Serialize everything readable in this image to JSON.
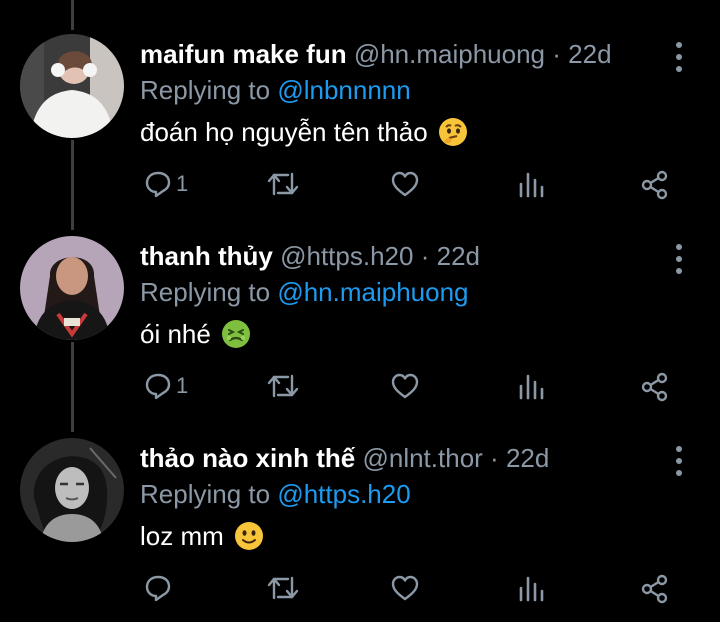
{
  "tweets": [
    {
      "name": "maifun make fun",
      "handle": "@hn.maiphuong",
      "separator": "·",
      "time": "22d",
      "replying_prefix": "Replying to",
      "replying_to": "@lnbnnnnn",
      "text": "đoán họ nguyễn tên thảo",
      "emoji": "thinking-face",
      "reply_count": "1"
    },
    {
      "name": "thanh thủy",
      "handle": "@https.h20",
      "separator": "·",
      "time": "22d",
      "replying_prefix": "Replying to",
      "replying_to": "@hn.maiphuong",
      "text": "ói nhé",
      "emoji": "nauseated-face",
      "reply_count": "1"
    },
    {
      "name": "thảo nào xinh thế",
      "handle": "@nlnt.thor",
      "separator": "·",
      "time": "22d",
      "replying_prefix": "Replying to",
      "replying_to": "@https.h20",
      "text": "loz mm",
      "emoji": "slightly-smiling-face",
      "reply_count": ""
    }
  ],
  "colors": {
    "background": "#000000",
    "muted": "#8b98a5",
    "mention": "#1d9bf0",
    "thread_line": "#3a3f45"
  }
}
